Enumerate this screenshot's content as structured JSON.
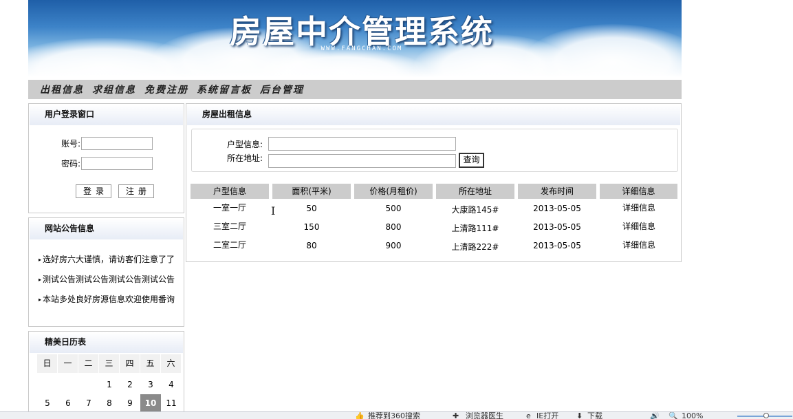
{
  "banner": {
    "title": "房屋中介管理系统",
    "subtitle": "WWW.FANGCHAN.COM"
  },
  "nav": {
    "items": [
      "出租信息",
      "求组信息",
      "免费注册",
      "系统留言板",
      "后台管理"
    ]
  },
  "login": {
    "title": "用户登录窗口",
    "account_label": "账号:",
    "password_label": "密码:",
    "login_button": "登录",
    "register_button": "注册"
  },
  "notice": {
    "title": "网站公告信息",
    "items": [
      "选好房六大谨慎，请访客们注意了了",
      "测试公告测试公告测试公告测试公告",
      "本站多处良好房源信息欢迎使用番询"
    ]
  },
  "calendar": {
    "title": "精美日历表",
    "weekdays": [
      "日",
      "一",
      "二",
      "三",
      "四",
      "五",
      "六"
    ],
    "week1": [
      "",
      "",
      "",
      "1",
      "2",
      "3",
      "4"
    ],
    "week2": [
      "5",
      "6",
      "7",
      "8",
      "9",
      "10",
      "11"
    ],
    "today": "10"
  },
  "main": {
    "title": "房屋出租信息",
    "search": {
      "layout_label": "户型信息:",
      "address_label": "所在地址:",
      "layout_value": "",
      "address_value": "",
      "query_button": "查询"
    },
    "table": {
      "headers": [
        "户型信息",
        "面积(平米)",
        "价格(月租价)",
        "所在地址",
        "发布时间",
        "详细信息"
      ],
      "rows": [
        [
          "一室一厅",
          "50",
          "500",
          "大康路145#",
          "2013-05-05",
          "详细信息"
        ],
        [
          "三室二厅",
          "150",
          "800",
          "上清路111#",
          "2013-05-05",
          "详细信息"
        ],
        [
          "二室二厅",
          "80",
          "900",
          "上清路222#",
          "2013-05-05",
          "详细信息"
        ]
      ]
    }
  },
  "statusbar": {
    "items": [
      "推荐到360搜索",
      "浏览器医生",
      "IE打开",
      "下载",
      "100%"
    ]
  }
}
